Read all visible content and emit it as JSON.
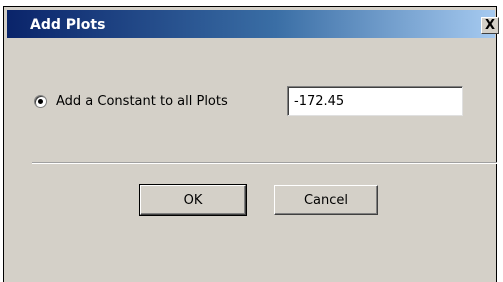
{
  "window": {
    "title": "Add Plots",
    "close_label": "X"
  },
  "option": {
    "label": "Add a Constant to all Plots",
    "selected": true
  },
  "constant_input": {
    "value": "-172.45"
  },
  "buttons": {
    "ok_label": "OK",
    "cancel_label": "Cancel"
  }
}
